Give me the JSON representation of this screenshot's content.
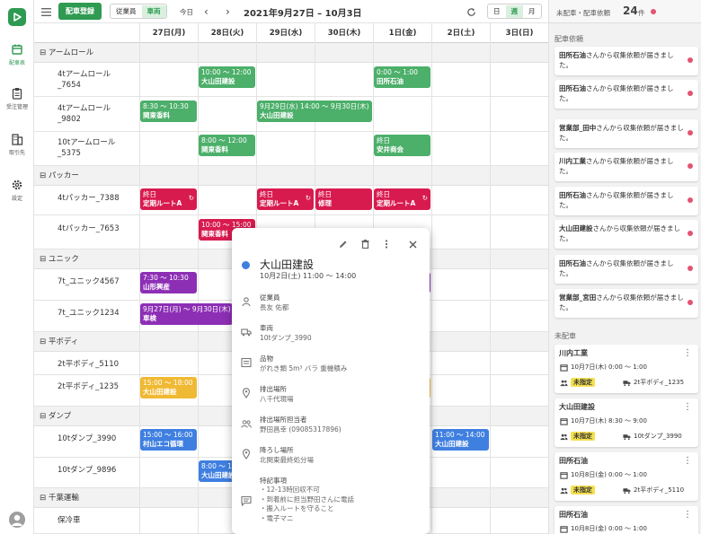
{
  "nav": {
    "items": [
      {
        "label": "配車表",
        "icon": "calendar-icon"
      },
      {
        "label": "受注管理",
        "icon": "clipboard-icon"
      },
      {
        "label": "取引先",
        "icon": "building-icon"
      },
      {
        "label": "設定",
        "icon": "gear-icon"
      }
    ]
  },
  "toolbar": {
    "register_button": "配車登録",
    "filter_options": [
      "従業員",
      "車両"
    ],
    "filter_selected": "車両",
    "today_button": "今日",
    "prev": "‹",
    "next": "›",
    "date_range": "2021年9月27日 – 10月3日",
    "view_options": [
      "日",
      "週",
      "月"
    ],
    "view_selected": "週"
  },
  "days": [
    "27日(月)",
    "28日(火)",
    "29日(水)",
    "30日(木)",
    "1日(金)",
    "2日(土)",
    "3日(日)"
  ],
  "groups": [
    {
      "name": "アームロール",
      "vehicles": [
        "4tアームロール\n_7654",
        "4tアームロール\n_9802",
        "10tアームロール\n_5375"
      ]
    },
    {
      "name": "パッカー",
      "vehicles": [
        "4tパッカー_7388",
        "4tパッカー_7653"
      ]
    },
    {
      "name": "ユニック",
      "vehicles": [
        "7t_ユニック4567",
        "7t_ユニック1234"
      ]
    },
    {
      "name": "平ボディ",
      "vehicles": [
        "2t平ボディ_5110",
        "2t平ボディ_1235"
      ]
    },
    {
      "name": "ダンプ",
      "vehicles": [
        "10tダンプ_3990",
        "10tダンプ_9896"
      ]
    },
    {
      "name": "千葉運輸",
      "vehicles": [
        "保冷車"
      ]
    }
  ],
  "events": [
    {
      "time": "10:00 ～ 12:00",
      "title": "大山田建設",
      "color": "green"
    },
    {
      "time": "0:00 ～ 1:00",
      "title": "田所石油",
      "color": "green"
    },
    {
      "time": "8:30 ～ 10:30",
      "title": "関東香料",
      "color": "green"
    },
    {
      "time": "9月29日(水) 14:00 ～ 9月30日(木)",
      "title": "大山田建設",
      "color": "green"
    },
    {
      "time": "8:00 ～ 12:00",
      "title": "関東香料",
      "color": "green"
    },
    {
      "time": "終日",
      "title": "安井商会",
      "color": "green"
    },
    {
      "time": "終日",
      "title": "定期ルートA",
      "color": "red"
    },
    {
      "time": "終日",
      "title": "定期ルートA",
      "color": "red"
    },
    {
      "time": "終日",
      "title": "修理",
      "color": "red"
    },
    {
      "time": "終日",
      "title": "定期ルートA",
      "color": "red"
    },
    {
      "time": "10:00 ～ 15:00",
      "title": "関東香料",
      "color": "red"
    },
    {
      "time": "7:30 ～ 10:30",
      "title": "山形興産",
      "color": "purple"
    },
    {
      "time": "9月27日(月) ～ 9月30日(木)",
      "title": "車検",
      "color": "purple"
    },
    {
      "time": "15:00 ～ 18:00",
      "title": "大山田建設",
      "color": "yellow"
    },
    {
      "time": "15:00 ～ 16:00",
      "title": "村山エコ循環",
      "color": "blue"
    },
    {
      "time": "11:00 ～ 14:00",
      "title": "大山田建設",
      "color": "blue"
    },
    {
      "time": "8:00 ～ 1",
      "title": "大山田建設",
      "color": "blue"
    }
  ],
  "popup": {
    "title": "大山田建設",
    "datetime": "10月2日(土) 11:00 ～ 14:00",
    "fields": [
      {
        "label": "従業員",
        "value": "長友 佑都"
      },
      {
        "label": "車両",
        "value": "10tダンプ_3990"
      },
      {
        "label": "品物",
        "value": "がれき類 5m³ バラ 重機積み"
      },
      {
        "label": "排出場所",
        "value": "八千代現場"
      },
      {
        "label": "排出場所担当者",
        "value": "野田昌幸 (09085317896)"
      },
      {
        "label": "降ろし場所",
        "value": "北関東最終処分場"
      },
      {
        "label": "特記事項",
        "value": "・12-13時回収不可\n・到着前に担当野田さんに電話\n・搬入ルートを守ること\n・電子マニ"
      }
    ]
  },
  "sidebar": {
    "header_label": "未配車・配車依頼",
    "count": "24",
    "count_unit": "件",
    "request_section": "配車依頼",
    "requests": [
      {
        "company": "田所石油",
        "text": "さんから収集依頼が届きました。"
      },
      {
        "company": "田所石油",
        "text": "さんから収集依頼が届きました。"
      },
      {
        "company": "営業部_田中",
        "text": "さんから収集依頼が届きました。"
      },
      {
        "company": "川内工業",
        "text": "さんから収集依頼が届きました。"
      },
      {
        "company": "田所石油",
        "text": "さんから収集依頼が届きました。"
      },
      {
        "company": "大山田建設",
        "text": "さんから収集依頼が届きました。"
      },
      {
        "company": "田所石油",
        "text": "さんから収集依頼が届きました。"
      },
      {
        "company": "営業部_宮田",
        "text": "さんから収集依頼が届きました。"
      }
    ],
    "unassigned_section": "未配車",
    "orders": [
      {
        "name": "川内工業",
        "time": "10月7日(木) 0:00 ～ 1:00",
        "status": "未指定",
        "vehicle": "2t平ボディ_1235"
      },
      {
        "name": "大山田建設",
        "time": "10月7日(木) 8:30 ～ 9:00",
        "status": "未指定",
        "vehicle": "10tダンプ_3990"
      },
      {
        "name": "田所石油",
        "time": "10月8日(金) 0:00 ～ 1:00",
        "status": "未指定",
        "vehicle": "2t平ボディ_5110"
      },
      {
        "name": "田所石油",
        "time": "10月8日(金) 0:00 ～ 1:00",
        "status": "",
        "vehicle": ""
      }
    ]
  }
}
